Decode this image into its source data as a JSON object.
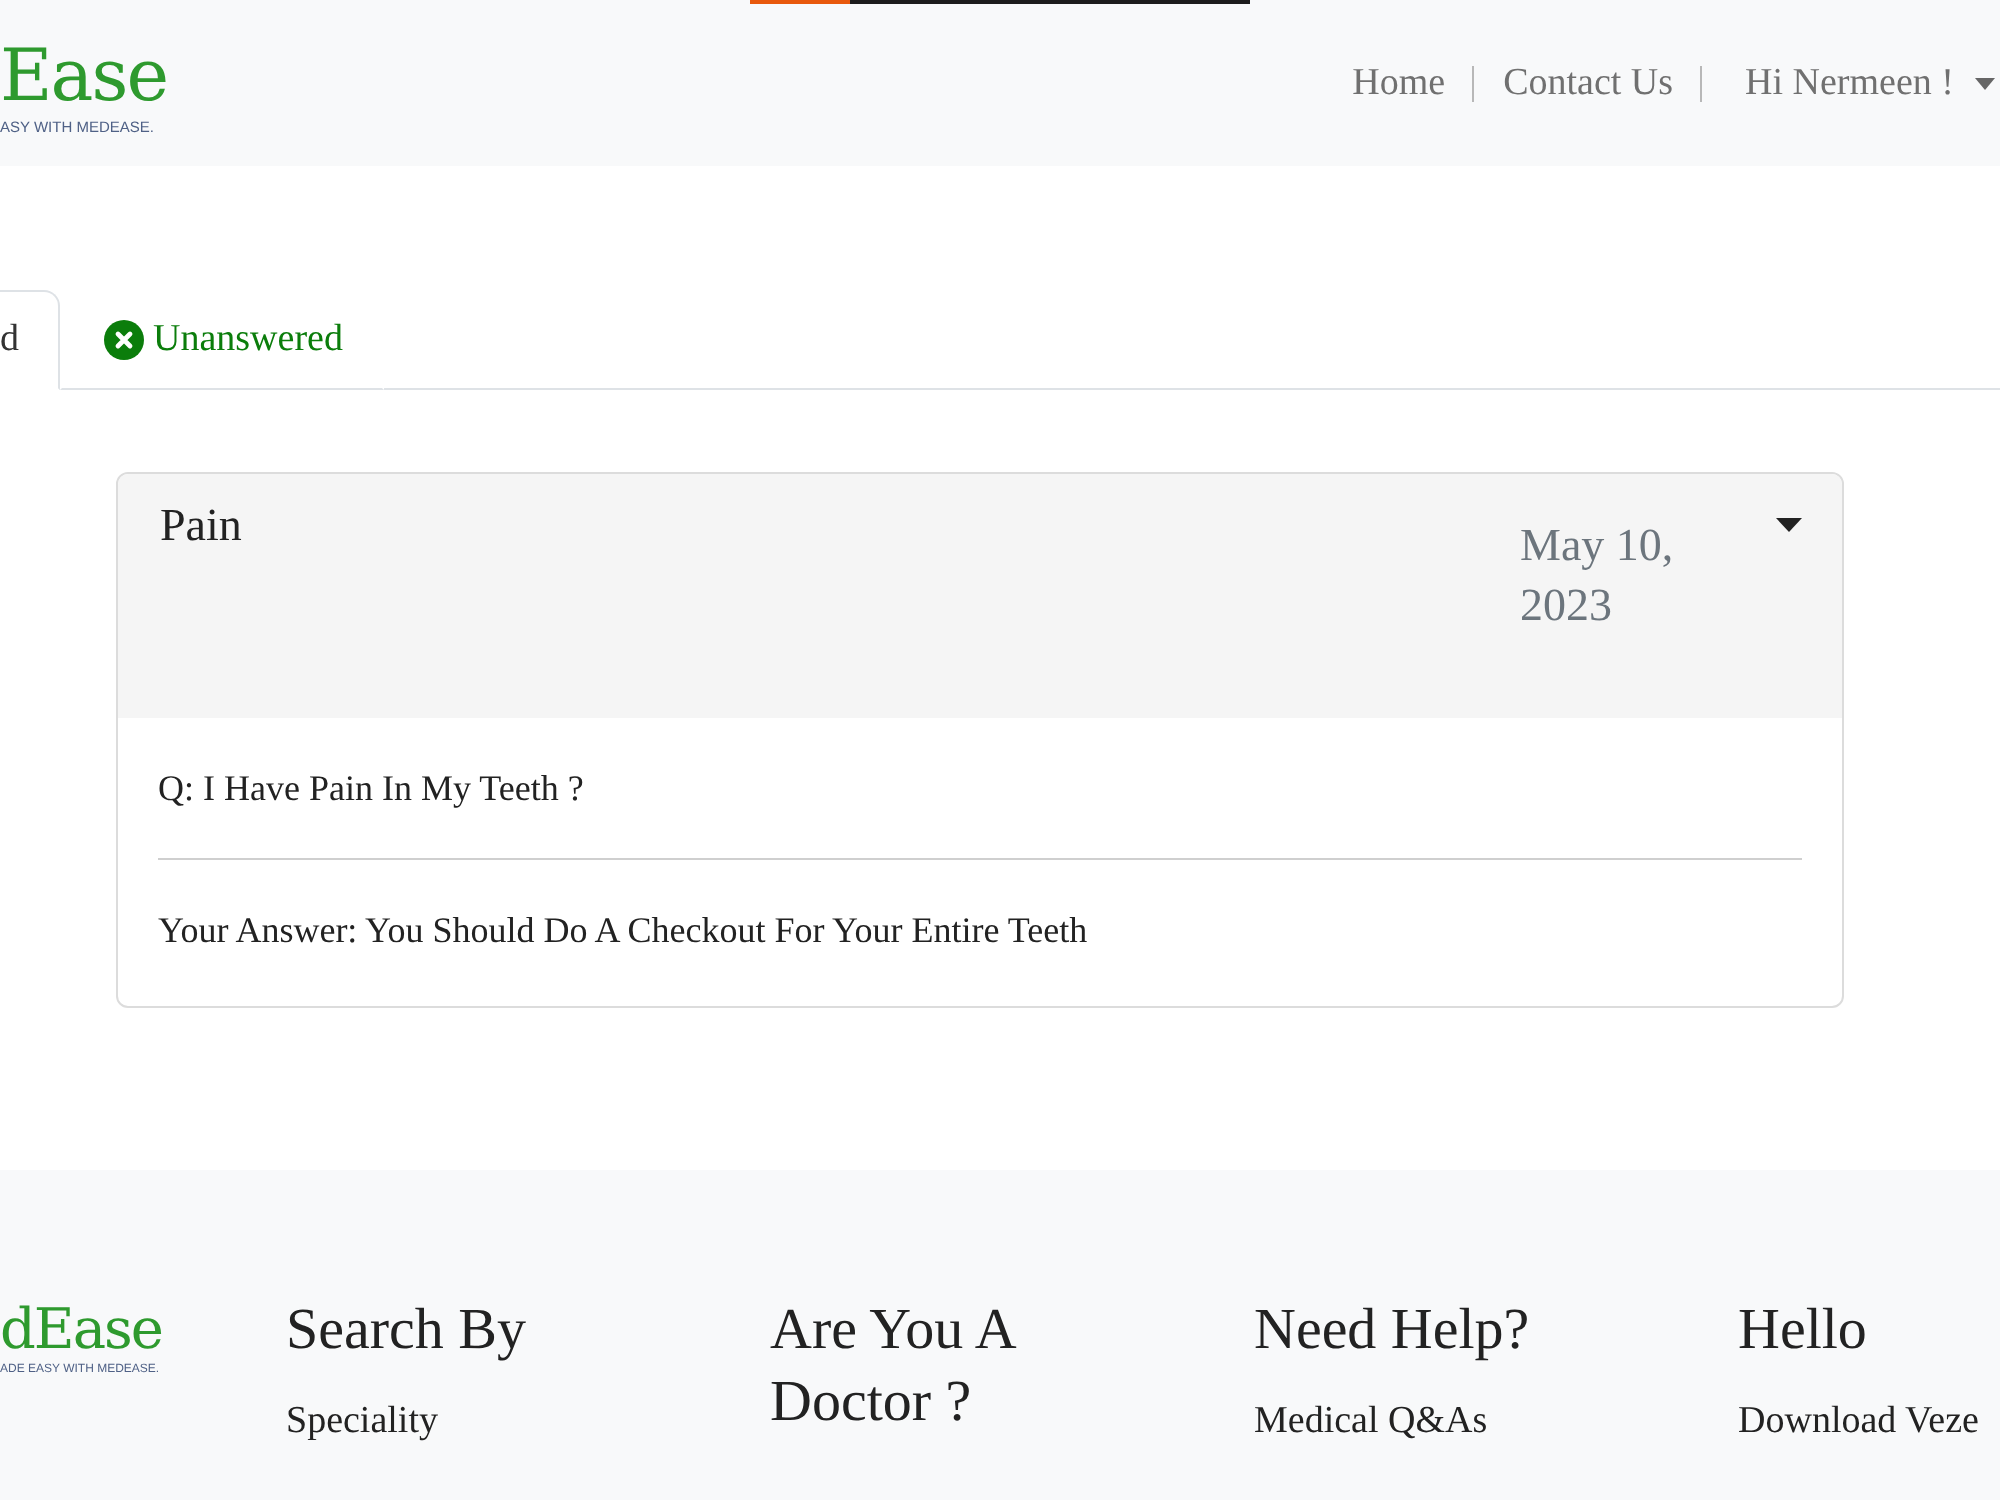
{
  "header": {
    "logo": {
      "name": "Ease",
      "tagline": "ASY WITH MEDEASE."
    },
    "nav": [
      {
        "label": "Home",
        "kind": "link"
      },
      {
        "label": "Contact Us",
        "kind": "link"
      },
      {
        "label": "Hi Nermeen !",
        "kind": "dropdown"
      }
    ]
  },
  "tabs": [
    {
      "label": "d",
      "selected": true
    },
    {
      "label": "Unanswered",
      "selected": false
    }
  ],
  "questions": [
    {
      "title": "Pain",
      "date": "May 10, 2023",
      "expanded": true,
      "question": "Q: I Have Pain In My Teeth ?",
      "answer": "Your Answer: You Should Do A Checkout For Your Entire Teeth"
    }
  ],
  "footer": {
    "logo": {
      "name": "dEase",
      "tagline": "ADE EASY WITH MEDEASE."
    },
    "columns": [
      {
        "heading": "Search By",
        "links": [
          "Speciality"
        ]
      },
      {
        "heading": "Are You A Doctor ?"
      },
      {
        "heading": "Need Help?",
        "links": [
          "Medical Q&As"
        ]
      },
      {
        "heading": "Hello",
        "links": [
          "Download Veze"
        ]
      }
    ]
  }
}
